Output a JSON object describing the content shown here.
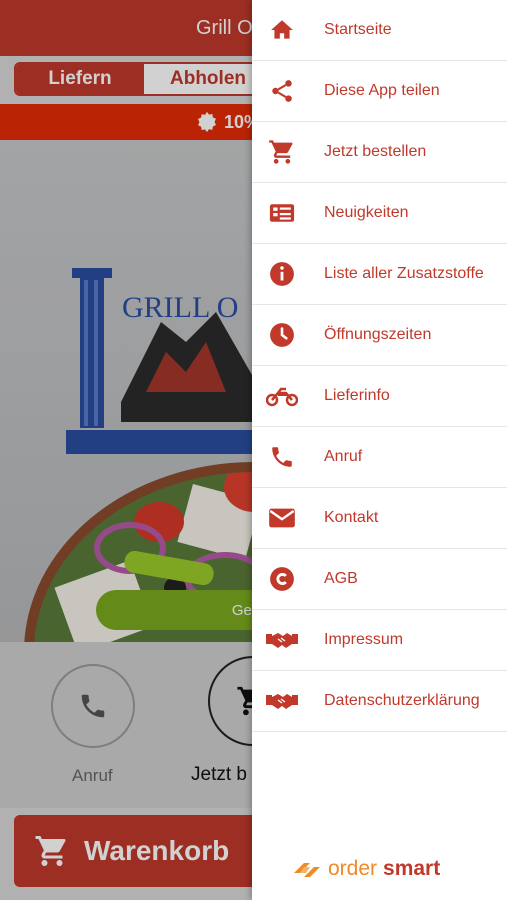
{
  "header": {
    "title": "Grill O"
  },
  "segmented": {
    "deliver": "Liefern",
    "pickup": "Abholen"
  },
  "banner": {
    "text": "10%"
  },
  "hero": {
    "logo_text": "GRILL O",
    "status_pill": "Geö"
  },
  "actions": {
    "call_label": "Anruf",
    "order_label": "Jetzt b"
  },
  "cart": {
    "label": "Warenkorb"
  },
  "menu": {
    "items": [
      {
        "label": "Startseite",
        "icon": "home-icon"
      },
      {
        "label": "Diese App teilen",
        "icon": "share-icon"
      },
      {
        "label": "Jetzt bestellen",
        "icon": "cart-icon"
      },
      {
        "label": "Neuigkeiten",
        "icon": "news-icon"
      },
      {
        "label": "Liste aller Zusatzstoffe",
        "icon": "info-icon"
      },
      {
        "label": "Öffnungszeiten",
        "icon": "clock-icon"
      },
      {
        "label": "Lieferinfo",
        "icon": "motorbike-icon"
      },
      {
        "label": "Anruf",
        "icon": "phone-icon"
      },
      {
        "label": "Kontakt",
        "icon": "mail-icon"
      },
      {
        "label": "AGB",
        "icon": "copyright-icon"
      },
      {
        "label": "Impressum",
        "icon": "handshake-icon"
      },
      {
        "label": "Datenschutzerklärung",
        "icon": "handshake-icon"
      }
    ]
  },
  "brand": {
    "word1": "order",
    "word2": "smart"
  },
  "colors": {
    "primary": "#c0392b",
    "banner": "#e52b07",
    "accent_green": "#7ba91f",
    "brand_orange": "#f08a24"
  }
}
